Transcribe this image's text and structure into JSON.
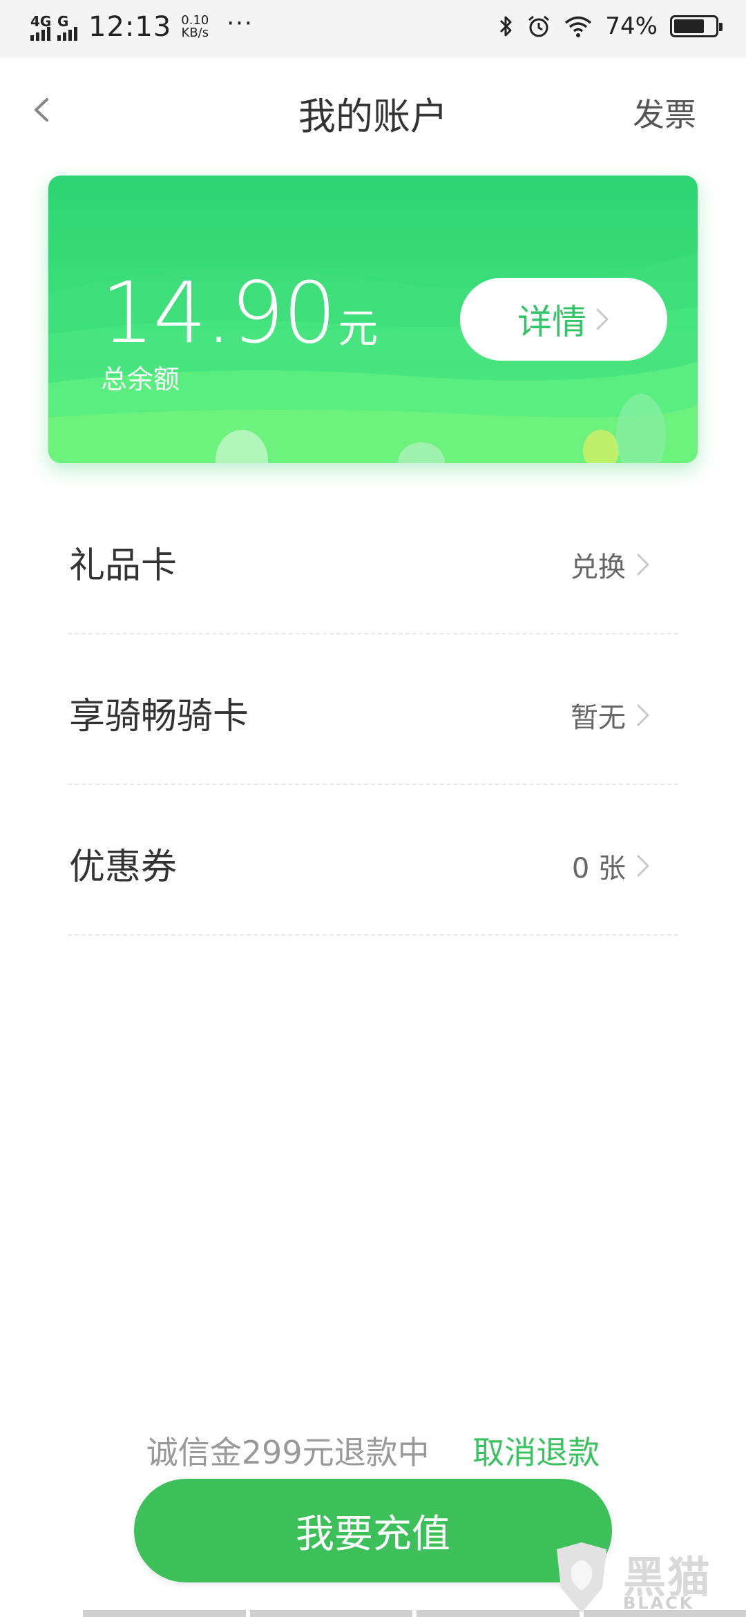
{
  "status_bar": {
    "network1": "4G",
    "network2": "G",
    "time": "12:13",
    "speed_value": "0.10",
    "speed_unit": "KB/s",
    "more": "···",
    "battery_percent": "74%",
    "battery_level": 0.74
  },
  "header": {
    "title": "我的账户",
    "invoice_label": "发票",
    "back_icon": "chevron-left-icon"
  },
  "balance_card": {
    "amount": "14.90",
    "unit": "元",
    "label": "总余额",
    "detail_label": "详情",
    "colors": {
      "start": "#2ed574",
      "end": "#55e878",
      "accent": "#33c467"
    }
  },
  "rows": [
    {
      "label": "礼品卡",
      "value": "兑换"
    },
    {
      "label": "享骑畅骑卡",
      "value": "暂无"
    },
    {
      "label": "优惠券",
      "value": "0 张"
    }
  ],
  "footer": {
    "refund_message": "诚信金299元退款中",
    "cancel_refund": "取消退款",
    "recharge_button": "我要充值",
    "recharge_color": "#3dc05a"
  },
  "watermark": {
    "text": "黑猫",
    "subtext": "BLACK CAT"
  }
}
